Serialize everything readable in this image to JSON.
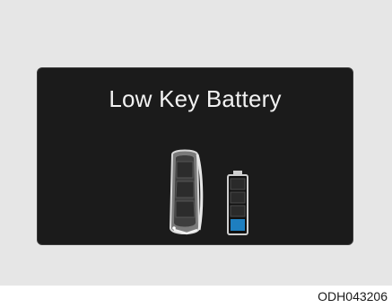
{
  "display": {
    "message": "Low Key Battery",
    "battery_level_fraction": 0.25
  },
  "icons": {
    "key_fob": "smart-key-fob-icon",
    "battery": "low-battery-icon"
  },
  "colors": {
    "screen_bg": "#1b1b1b",
    "text": "#f2f2f2",
    "battery_fill": "#1e7fc0"
  },
  "caption": {
    "code": "ODH043206"
  }
}
